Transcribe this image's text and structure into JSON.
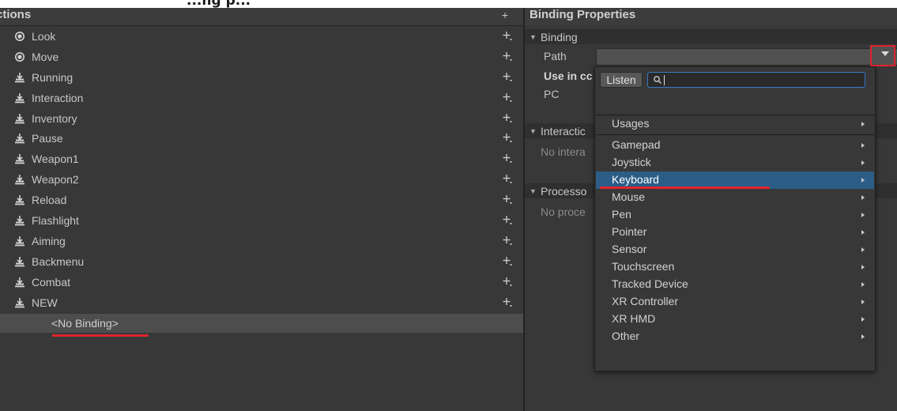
{
  "caption": "...ng p...",
  "left_panel": {
    "title": "ctions",
    "add_symbol": "+",
    "actions": [
      {
        "label": "Look",
        "icon": "radio-icon"
      },
      {
        "label": "Move",
        "icon": "radio-icon"
      },
      {
        "label": "Running",
        "icon": "button-action-icon"
      },
      {
        "label": "Interaction",
        "icon": "button-action-icon"
      },
      {
        "label": "Inventory",
        "icon": "button-action-icon"
      },
      {
        "label": "Pause",
        "icon": "button-action-icon"
      },
      {
        "label": "Weapon1",
        "icon": "button-action-icon"
      },
      {
        "label": "Weapon2",
        "icon": "button-action-icon"
      },
      {
        "label": "Reload",
        "icon": "button-action-icon"
      },
      {
        "label": "Flashlight",
        "icon": "button-action-icon"
      },
      {
        "label": "Aiming",
        "icon": "button-action-icon"
      },
      {
        "label": "Backmenu",
        "icon": "button-action-icon"
      },
      {
        "label": "Combat",
        "icon": "button-action-icon"
      },
      {
        "label": "NEW",
        "icon": "button-action-icon"
      }
    ],
    "selected_binding": "<No Binding>"
  },
  "right_panel": {
    "title": "Binding Properties",
    "binding_section": "Binding",
    "path_label": "Path",
    "use_in_label": "Use in cc",
    "pc_label": "PC",
    "interactions_section": "Interactic",
    "no_interactions": "No intera",
    "processors_section": "Processo",
    "no_processors": "No proce"
  },
  "dropdown": {
    "listen_label": "Listen",
    "search_value": "",
    "usages_label": "Usages",
    "devices": [
      "Gamepad",
      "Joystick",
      "Keyboard",
      "Mouse",
      "Pen",
      "Pointer",
      "Sensor",
      "Touchscreen",
      "Tracked Device",
      "XR Controller",
      "XR HMD",
      "Other"
    ],
    "selected": "Keyboard"
  },
  "colors": {
    "accent_selection": "#2c5d87",
    "annotation_red": "#e0242c",
    "search_focus": "#3a79c9",
    "panel_bg": "#383838"
  }
}
